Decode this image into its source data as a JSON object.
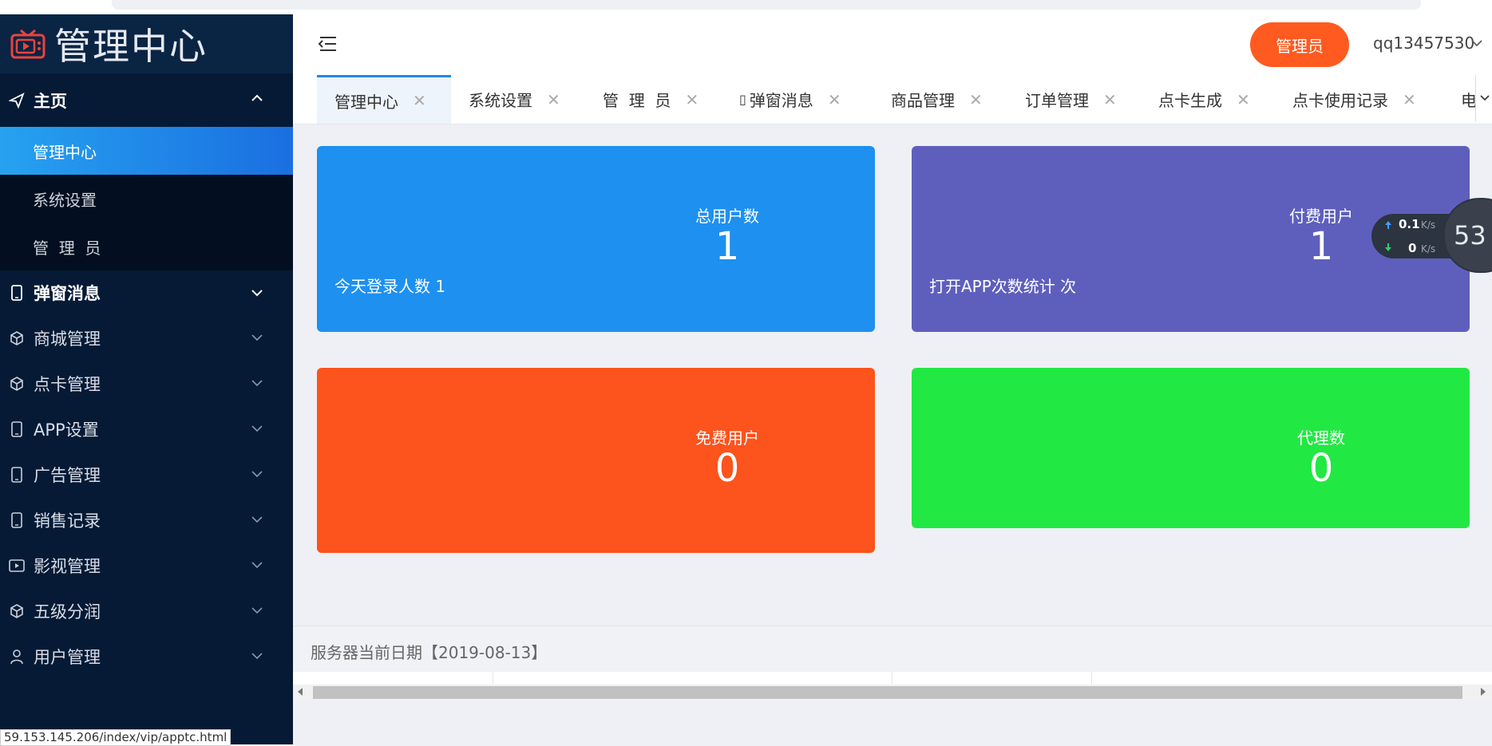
{
  "logo": {
    "text": "管理中心"
  },
  "sidebar": {
    "home": {
      "label": "主页"
    },
    "home_sub": [
      "管理中心",
      "系统设置",
      "管  理  员"
    ],
    "items": [
      {
        "label": "弹窗消息",
        "icon": "mobile-icon"
      },
      {
        "label": "商城管理",
        "icon": "cube-icon"
      },
      {
        "label": "点卡管理",
        "icon": "cube-icon"
      },
      {
        "label": "APP设置",
        "icon": "mobile-icon"
      },
      {
        "label": "广告管理",
        "icon": "mobile-icon"
      },
      {
        "label": "销售记录",
        "icon": "mobile-icon"
      },
      {
        "label": "影视管理",
        "icon": "video-icon"
      },
      {
        "label": "五级分润",
        "icon": "cube-icon"
      },
      {
        "label": "用户管理",
        "icon": "user-icon"
      }
    ]
  },
  "header": {
    "role_label": "管理员",
    "username": "qq13457530"
  },
  "tabs": [
    {
      "label": "管理中心"
    },
    {
      "label": "系统设置"
    },
    {
      "label": "管  理  员"
    },
    {
      "label": "弹窗消息",
      "prefix": "▯"
    },
    {
      "label": "商品管理"
    },
    {
      "label": "订单管理"
    },
    {
      "label": "点卡生成"
    },
    {
      "label": "点卡使用记录"
    },
    {
      "label": "电"
    }
  ],
  "cards": {
    "total_users": {
      "title": "总用户数",
      "value": "1",
      "sub": "今天登录人数 1",
      "color": "#1e90f0"
    },
    "paid_users": {
      "title": "付费用户",
      "value": "1",
      "sub": "打开APP次数统计 次",
      "color": "#5e5fbd"
    },
    "free_users": {
      "title": "免费用户",
      "value": "0",
      "color": "#fd531c"
    },
    "agents": {
      "title": "代理数",
      "value": "0",
      "color": "#22e843"
    }
  },
  "net_widget": {
    "up": "0.1",
    "down": "0",
    "unit": "K/s",
    "percent": "53"
  },
  "footer": {
    "text": "服务器当前日期【2019-08-13】"
  },
  "status_bar": {
    "url": "59.153.145.206/index/vip/apptc.html"
  }
}
